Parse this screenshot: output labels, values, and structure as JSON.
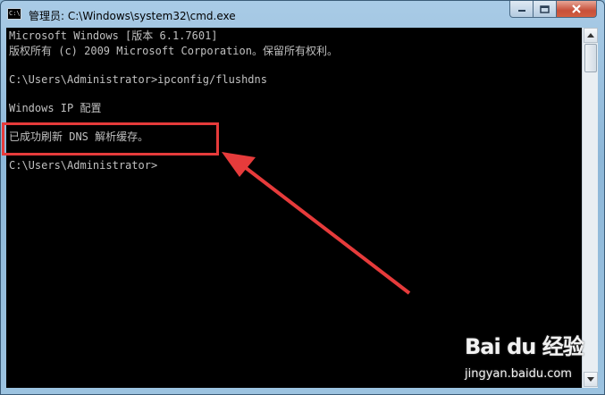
{
  "window": {
    "title": "管理员: C:\\Windows\\system32\\cmd.exe",
    "app_icon_text": "C:\\"
  },
  "console": {
    "lines": [
      "Microsoft Windows [版本 6.1.7601]",
      "版权所有 (c) 2009 Microsoft Corporation。保留所有权利。",
      "C:\\Users\\Administrator>ipconfig/flushdns",
      "Windows IP 配置",
      "已成功刷新 DNS 解析缓存。",
      "C:\\Users\\Administrator>"
    ]
  },
  "annotation": {
    "color": "#e63b3b"
  },
  "watermark": {
    "logo": "Bai du 经验",
    "url": "jingyan.baidu.com"
  },
  "icons": [
    "minimize-icon",
    "maximize-icon",
    "close-icon",
    "scroll-up-icon",
    "scroll-down-icon"
  ]
}
